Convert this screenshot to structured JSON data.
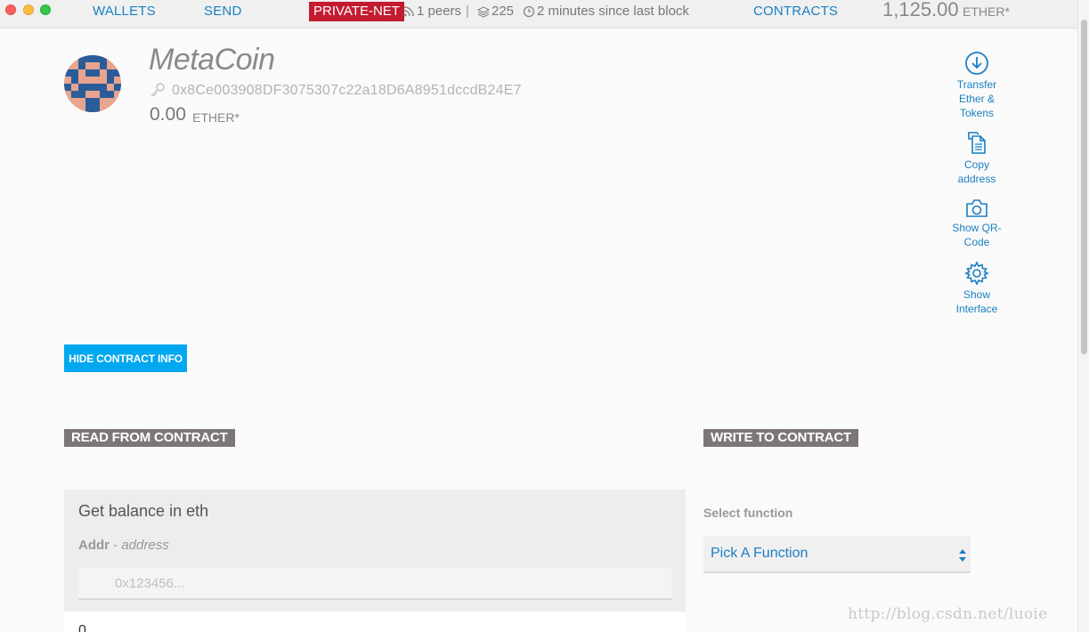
{
  "topbar": {
    "nav": {
      "wallets": "WALLETS",
      "send": "SEND",
      "contracts": "CONTRACTS"
    },
    "network_badge": "PRIVATE-NET",
    "peers": "1 peers",
    "separator": "|",
    "blocks": "225",
    "last_block": "2 minutes since last block",
    "balance": "1,125.00",
    "balance_unit": "ETHER*"
  },
  "contract": {
    "name": "MetaCoin",
    "address": "0x8Ce003908DF3075307c22a18D6A8951dccdB24E7",
    "balance": "0.00",
    "balance_unit": "ETHER*"
  },
  "actions": {
    "transfer_line1": "Transfer",
    "transfer_line2": "Ether &",
    "transfer_line3": "Tokens",
    "copy_line1": "Copy",
    "copy_line2": "address",
    "qr_line1": "Show QR-",
    "qr_line2": "Code",
    "iface_line1": "Show",
    "iface_line2": "Interface"
  },
  "hide_info_button": "HIDE CONTRACT INFO",
  "read_section": {
    "title": "READ FROM CONTRACT",
    "function_name": "Get balance in eth",
    "param_name": "Addr",
    "param_sep": " - ",
    "param_type": "address",
    "param_placeholder": "0x123456...",
    "result": "0"
  },
  "write_section": {
    "title": "WRITE TO CONTRACT",
    "select_label": "Select function",
    "select_value": "Pick A Function"
  },
  "watermark": "http://blog.csdn.net/luoie",
  "colors": {
    "accent": "#1a7fc2",
    "network_badge": "#c31b30",
    "button": "#00a8f0",
    "section_header": "#7c7676"
  }
}
